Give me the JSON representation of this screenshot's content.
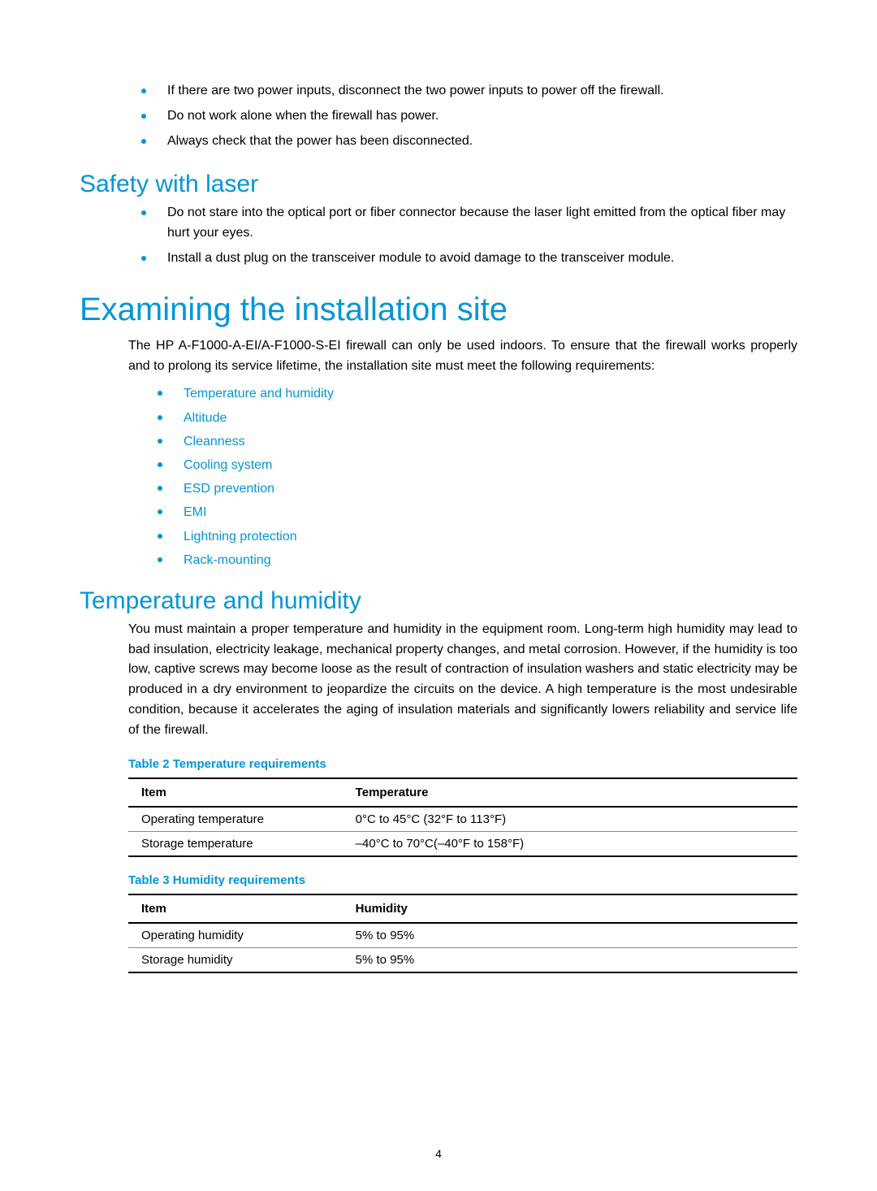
{
  "topBullets": [
    "If there are two power inputs, disconnect the two power inputs to power off the firewall.",
    "Do not work alone when the firewall has power.",
    "Always check that the power has been disconnected."
  ],
  "laserHeading": "Safety with laser",
  "laserBullets": [
    "Do not stare into the optical port or fiber connector because the laser light emitted from the optical fiber may hurt your eyes.",
    "Install a dust plug on the transceiver module to avoid damage to the transceiver module."
  ],
  "examHeading": "Examining the installation site",
  "examIntro": "The HP A-F1000-A-EI/A-F1000-S-EI firewall can only be used indoors. To ensure that the firewall works properly and to prolong its service lifetime, the installation site must meet the following requirements:",
  "requirementLinks": [
    "Temperature and humidity",
    "Altitude",
    "Cleanness",
    "Cooling system",
    "ESD prevention",
    "EMI",
    "Lightning protection",
    "Rack-mounting"
  ],
  "tempHeading": "Temperature and humidity",
  "tempBody": "You must maintain a proper temperature and humidity in the equipment room. Long-term high humidity may lead to bad insulation, electricity leakage, mechanical property changes, and metal corrosion. However, if the humidity is too low, captive screws may become loose as the result of contraction of insulation washers and static electricity may be produced in a dry environment to jeopardize the circuits on the device. A high temperature is the most undesirable condition, because it accelerates the aging of insulation materials and significantly lowers reliability and service life of the firewall.",
  "table2Caption": "Table 2 Temperature requirements",
  "table2Headers": {
    "c0": "Item",
    "c1": "Temperature"
  },
  "table2Rows": [
    {
      "c0": "Operating temperature",
      "c1": "0°C to 45°C (32°F to 113°F)"
    },
    {
      "c0": "Storage temperature",
      "c1": "–40°C to 70°C(–40°F to 158°F)"
    }
  ],
  "table3Caption": "Table 3 Humidity requirements",
  "table3Headers": {
    "c0": "Item",
    "c1": "Humidity"
  },
  "table3Rows": [
    {
      "c0": "Operating humidity",
      "c1": "5% to 95%"
    },
    {
      "c0": "Storage humidity",
      "c1": "5% to 95%"
    }
  ],
  "pageNumber": "4"
}
